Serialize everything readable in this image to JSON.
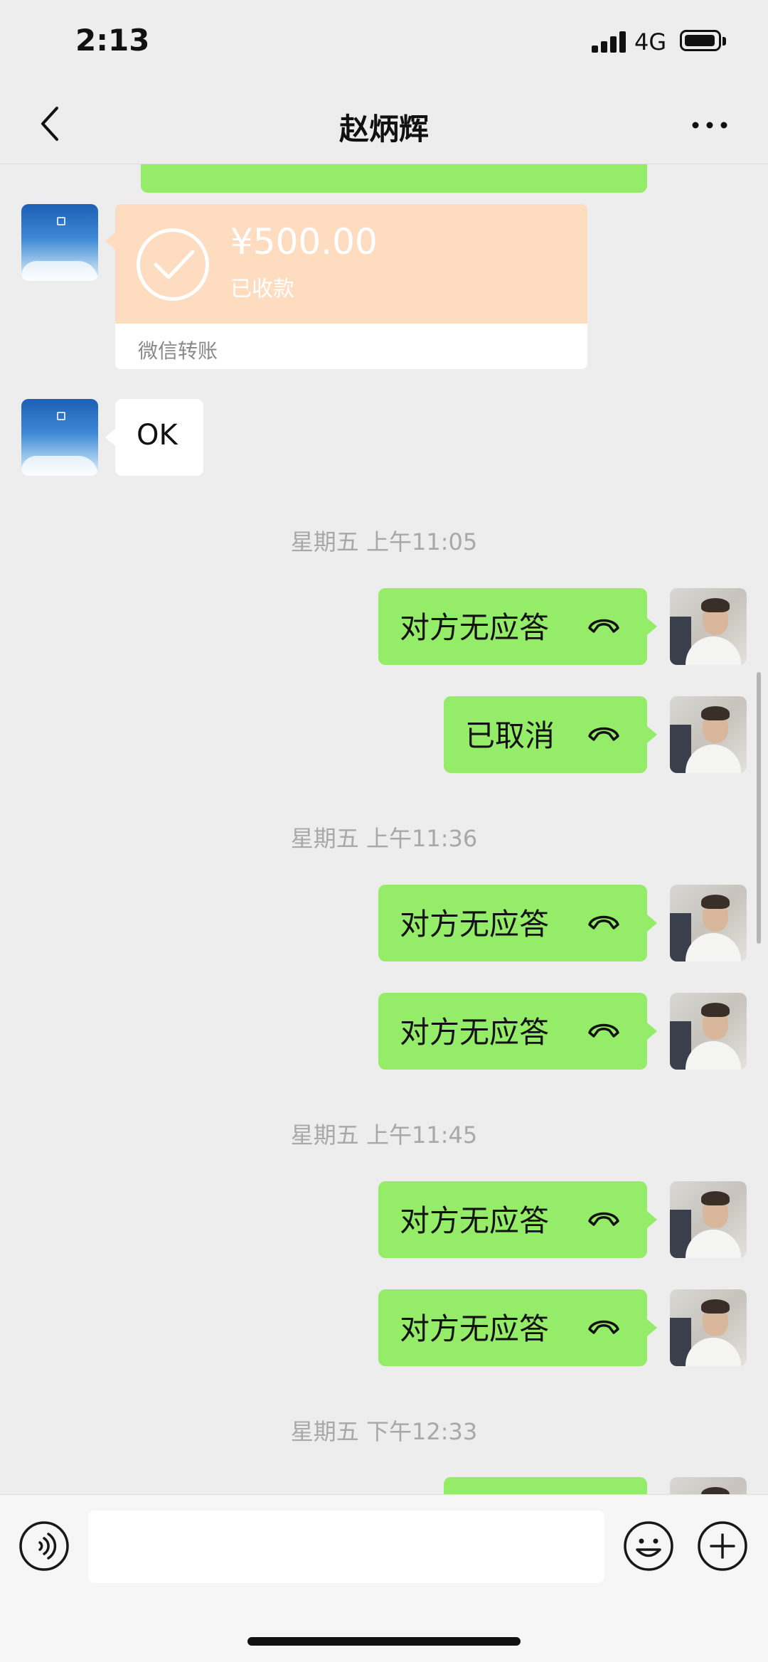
{
  "status_bar": {
    "time": "2:13",
    "network": "4G"
  },
  "header": {
    "title": "赵炳辉",
    "back_icon": "chevron-left-icon",
    "more_icon": "more-horizontal-icon"
  },
  "messages": {
    "transfer": {
      "amount": "¥500.00",
      "status": "已收款",
      "footer": "微信转账"
    },
    "ok_text": "OK",
    "time_1": "星期五 上午11:05",
    "call_1": "对方无应答",
    "call_2": "已取消",
    "time_2": "星期五 上午11:36",
    "call_3": "对方无应答",
    "call_4": "对方无应答",
    "time_3": "星期五 上午11:45",
    "call_5": "对方无应答",
    "call_6": "对方无应答",
    "time_4": "星期五 下午12:33"
  },
  "input_bar": {
    "placeholder": "",
    "voice_icon": "voice-icon",
    "emoji_icon": "emoji-icon",
    "plus_icon": "plus-icon"
  },
  "colors": {
    "background": "#ededed",
    "outgoing_bubble": "#95ec69",
    "incoming_bubble": "#ffffff",
    "transfer_card": "#fddcc0"
  }
}
